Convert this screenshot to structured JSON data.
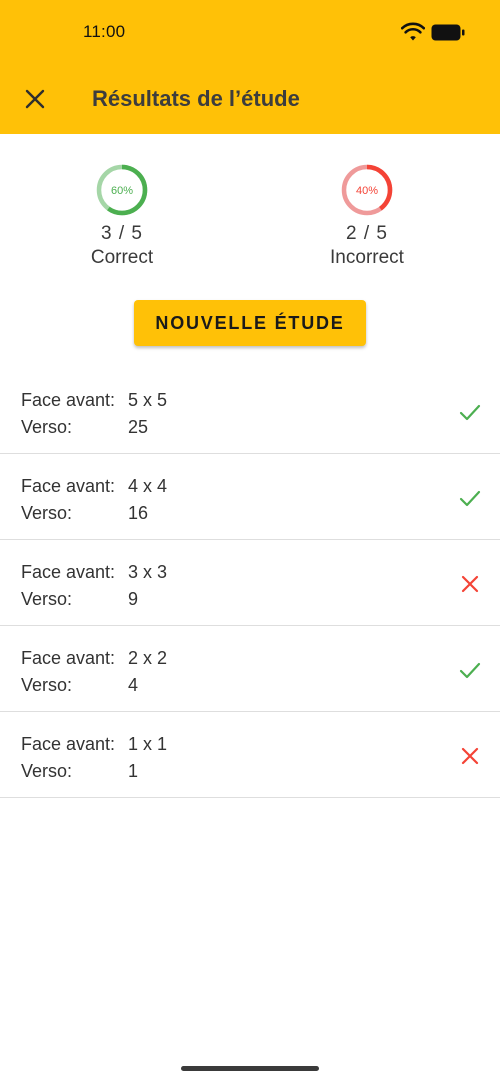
{
  "status_bar": {
    "time": "11:00"
  },
  "header": {
    "title": "Résultats de l’étude"
  },
  "stats": {
    "correct": {
      "percent_label": "60%",
      "fraction": 0.6,
      "count": "3 / 5",
      "label": "Correct",
      "color": "#4CAF50",
      "track_color": "#A5D6A7"
    },
    "incorrect": {
      "percent_label": "40%",
      "fraction": 0.4,
      "count": "2 / 5",
      "label": "Incorrect",
      "color": "#F44336",
      "track_color": "#EF9A9A"
    }
  },
  "new_study_button": {
    "label": "NOUVELLE ÉTUDE"
  },
  "results": [
    {
      "front_key": "Face avant:",
      "front_value": "5 x 5",
      "back_key": "Verso:",
      "back_value": "25",
      "status": "correct"
    },
    {
      "front_key": "Face avant:",
      "front_value": "4 x 4",
      "back_key": "Verso:",
      "back_value": "16",
      "status": "correct"
    },
    {
      "front_key": "Face avant:",
      "front_value": "3 x 3",
      "back_key": "Verso:",
      "back_value": "9",
      "status": "incorrect"
    },
    {
      "front_key": "Face avant:",
      "front_value": "2 x 2",
      "back_key": "Verso:",
      "back_value": "4",
      "status": "correct"
    },
    {
      "front_key": "Face avant:",
      "front_value": "1 x 1",
      "back_key": "Verso:",
      "back_value": "1",
      "status": "incorrect"
    }
  ],
  "colors": {
    "accent": "#FFC107",
    "correct": "#4CAF50",
    "incorrect": "#F44336"
  },
  "icons": {
    "close": "close-icon",
    "correct": "check-icon",
    "incorrect": "cross-icon",
    "wifi": "wifi-icon",
    "battery": "battery-icon"
  }
}
